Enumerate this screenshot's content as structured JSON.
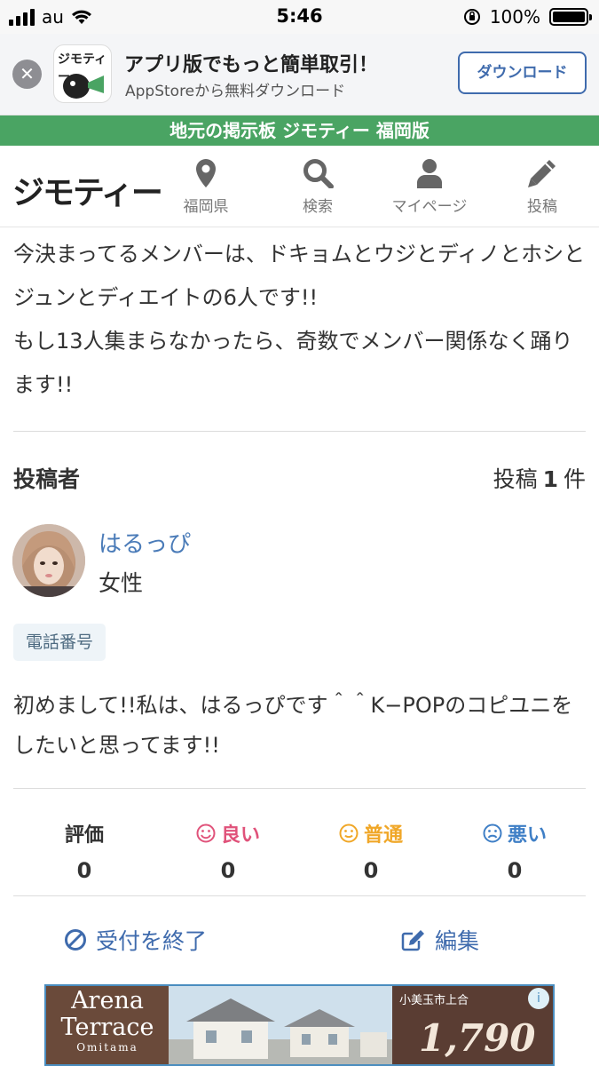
{
  "status_bar": {
    "carrier": "au",
    "time": "5:46",
    "battery": "100%"
  },
  "app_banner": {
    "title": "アプリ版でもっと簡単取引！",
    "subtitle": "AppStoreから無料ダウンロード",
    "download_label": "ダウンロード",
    "logo_text": "ジモティー"
  },
  "green_bar": {
    "text": "地元の掲示板 ジモティー 福岡版"
  },
  "header": {
    "logo": "ジモティー",
    "nav": [
      {
        "label": "福岡県",
        "icon": "location-pin-icon"
      },
      {
        "label": "検索",
        "icon": "search-icon"
      },
      {
        "label": "マイページ",
        "icon": "user-icon"
      },
      {
        "label": "投稿",
        "icon": "pencil-icon"
      }
    ]
  },
  "post": {
    "description": "今決まってるメンバーは、ドキョムとウジとディノとホシとジュンとディエイトの6人です!!\nもし13人集まらなかったら、奇数でメンバー関係なく踊ります!!"
  },
  "poster": {
    "heading": "投稿者",
    "count_prefix": "投稿",
    "count": "1",
    "count_suffix": "件",
    "name": "はるっぴ",
    "gender": "女性",
    "tag": "電話番号",
    "intro": "初めまして!!私は、はるっぴです＾＾K−POPのコピユニをしたいと思ってます!!"
  },
  "evaluation": {
    "items": [
      {
        "label": "評価",
        "value": "0",
        "color": "#333333"
      },
      {
        "label": "良い",
        "value": "0",
        "color": "#e0527a"
      },
      {
        "label": "普通",
        "value": "0",
        "color": "#f0a728"
      },
      {
        "label": "悪い",
        "value": "0",
        "color": "#3f7fc6"
      }
    ]
  },
  "actions": {
    "close_label": "受付を終了",
    "edit_label": "編集"
  },
  "ad": {
    "brand_line1": "Arena",
    "brand_line2": "Terrace",
    "brand_line3": "Omitama",
    "location": "小美玉市上合",
    "price": "1,790"
  },
  "colors": {
    "accent": "#3f6bad",
    "green": "#4aa463",
    "link": "#4a7bb8"
  }
}
